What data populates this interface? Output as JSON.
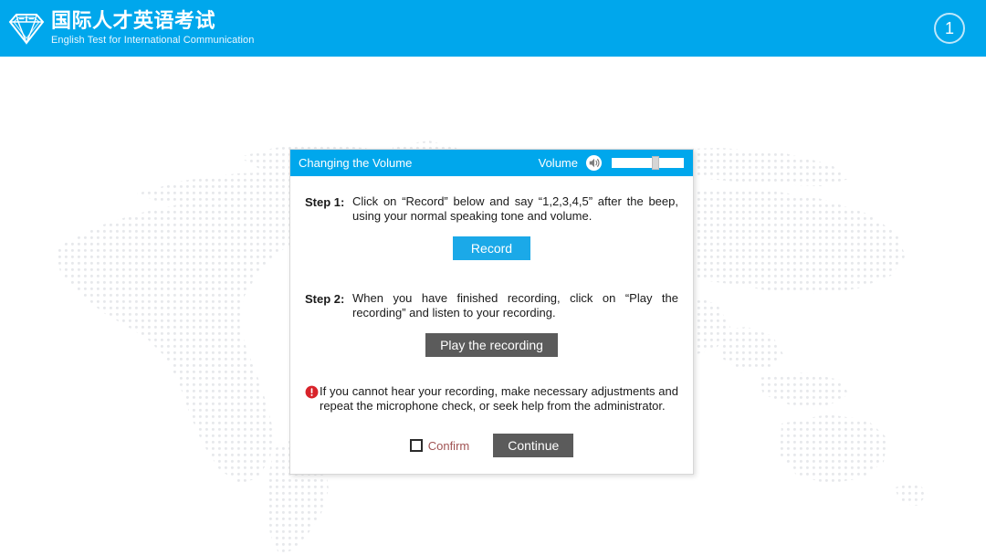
{
  "header": {
    "logo_icon": "diamond-gem-icon",
    "title_cn": "国际人才英语考试",
    "title_en": "English Test for International Communication",
    "page_number": "1",
    "brand_color": "#00a7ec"
  },
  "background": {
    "type": "dotted-world-map",
    "dot_color": "#d3d7db"
  },
  "dialog": {
    "title": "Changing the Volume",
    "volume_label": "Volume",
    "speaker_icon": "speaker-icon",
    "volume_value": 62,
    "titlebar_color": "#00a7ec",
    "steps": [
      {
        "label": "Step 1:",
        "text": "Click on “Record” below and say “1,2,3,4,5” after the beep, using your normal speaking tone and volume."
      },
      {
        "label": "Step 2:",
        "text": "When you have finished recording, click on “Play the recording” and listen to your recording."
      }
    ],
    "record_button": "Record",
    "record_button_color": "#1ba9e8",
    "play_button": "Play the recording",
    "play_button_color": "#5b5b5b",
    "warning_icon": "alert-circle-icon",
    "warning_color": "#d8232a",
    "warning_text": "If you cannot hear your recording, make necessary adjustments and repeat the microphone check, or seek help from the administrator.",
    "confirm_label": "Confirm",
    "confirm_label_color": "#a05353",
    "confirm_checked": false,
    "continue_button": "Continue",
    "continue_button_color": "#5b5b5b"
  }
}
